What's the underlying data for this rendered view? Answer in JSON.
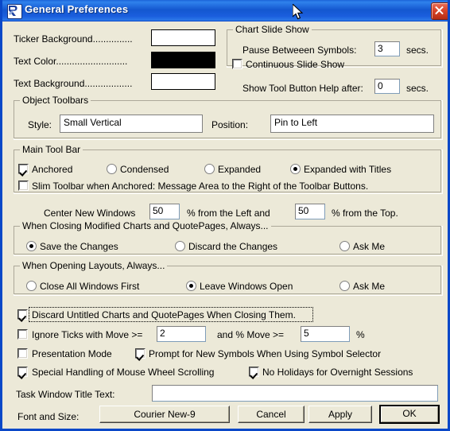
{
  "window": {
    "title": "General Preferences",
    "icon": "app-logo-icon",
    "close_label": "×",
    "accent_color": "#0a48c8",
    "face_color": "#ece9d8"
  },
  "colors_section": {
    "rows": [
      {
        "label": "Ticker Background...............",
        "swatch_color": "#ffffff",
        "name": "ticker-background"
      },
      {
        "label": "Text Color...........................",
        "swatch_color": "#000000",
        "name": "text-color"
      },
      {
        "label": "Text Background..................",
        "swatch_color": "#ffffff",
        "name": "text-background"
      }
    ]
  },
  "chart_slide_show": {
    "title": "Chart Slide Show",
    "pause_label": "Pause Betweeen Symbols:",
    "pause_value": "3",
    "pause_units": "secs.",
    "continuous_label": "Continuous Slide Show",
    "continuous_checked": false
  },
  "tool_button_help": {
    "label": "Show Tool Button Help after:",
    "value": "0",
    "units": "secs."
  },
  "object_toolbars": {
    "title": "Object Toolbars",
    "style_label": "Style:",
    "style_value": "Small Vertical",
    "position_label": "Position:",
    "position_value": "Pin to Left"
  },
  "main_tool_bar": {
    "title": "Main Tool Bar",
    "anchored_label": "Anchored",
    "anchored_checked": true,
    "options": [
      {
        "label": "Condensed",
        "selected": false
      },
      {
        "label": "Expanded",
        "selected": false
      },
      {
        "label": "Expanded with Titles",
        "selected": true
      }
    ],
    "slim_label": "Slim Toolbar when Anchored: Message Area to the Right of the Toolbar Buttons.",
    "slim_checked": false
  },
  "center_new_windows": {
    "label": "Center New Windows",
    "left_value": "50",
    "left_units": "% from the Left and",
    "top_value": "50",
    "top_units": "% from the Top."
  },
  "closing_modified": {
    "title": "When Closing Modified Charts and QuotePages, Always...",
    "options": [
      {
        "label": "Save the Changes",
        "selected": true
      },
      {
        "label": "Discard the Changes",
        "selected": false
      },
      {
        "label": "Ask Me",
        "selected": false
      }
    ]
  },
  "opening_layouts": {
    "title": "When Opening Layouts, Always...",
    "options": [
      {
        "label": "Close All Windows First",
        "selected": false
      },
      {
        "label": "Leave Windows Open",
        "selected": true
      },
      {
        "label": "Ask Me",
        "selected": false
      }
    ]
  },
  "misc_checkboxes": {
    "discard_untitled": {
      "label": "Discard Untitled Charts and QuotePages When Closing Them.",
      "checked": true,
      "focused": true
    },
    "ignore_ticks": {
      "label": "Ignore Ticks with Move >=",
      "checked": false,
      "move_value": "2",
      "mid_label": "and % Move >=",
      "pct_value": "5",
      "pct_units": "%"
    },
    "presentation_mode": {
      "label": "Presentation Mode",
      "checked": false
    },
    "prompt_new_symbols": {
      "label": "Prompt for New Symbols When Using Symbol Selector",
      "checked": true
    },
    "mouse_wheel": {
      "label": "Special Handling of Mouse Wheel Scrolling",
      "checked": true
    },
    "no_holidays": {
      "label": "No Holidays for Overnight Sessions",
      "checked": true
    }
  },
  "task_window": {
    "label": "Task Window Title Text:",
    "value": "",
    "placeholder": ""
  },
  "footer": {
    "font_label": "Font and Size:",
    "font_button": "Courier New-9",
    "cancel_button": "Cancel",
    "apply_button": "Apply",
    "ok_button": "OK"
  }
}
